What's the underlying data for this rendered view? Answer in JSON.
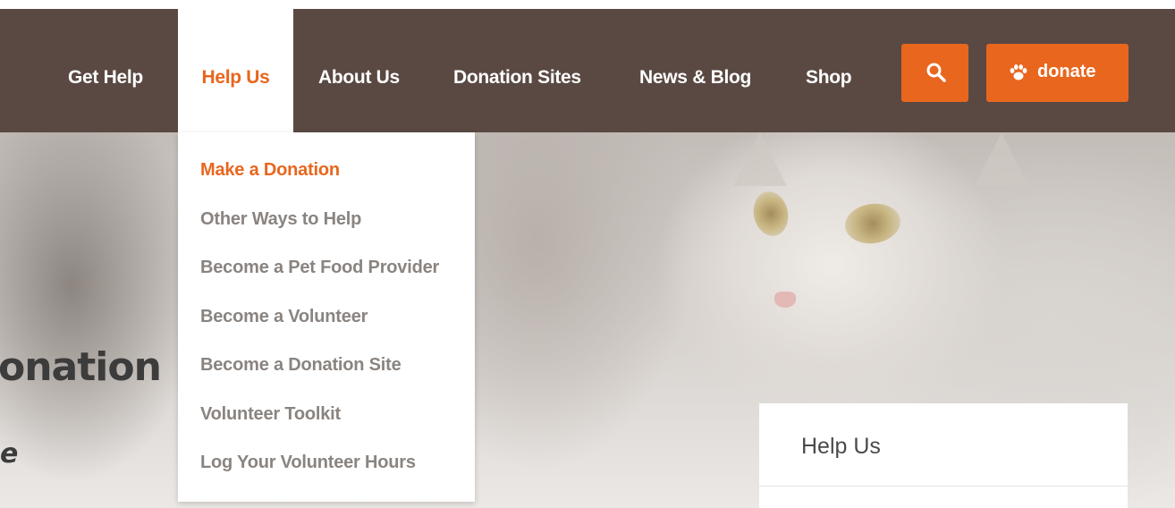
{
  "nav": {
    "items": [
      {
        "label": "Get Help",
        "active": false
      },
      {
        "label": "Help Us",
        "active": true
      },
      {
        "label": "About Us",
        "active": false
      },
      {
        "label": "Donation Sites",
        "active": false
      },
      {
        "label": "News & Blog",
        "active": false
      },
      {
        "label": "Shop",
        "active": false
      }
    ],
    "search_icon": "search-icon",
    "donate_label": "donate",
    "donate_icon": "paw-icon"
  },
  "dropdown": {
    "items": [
      {
        "label": "Make a Donation",
        "active": true
      },
      {
        "label": "Other Ways to Help",
        "active": false
      },
      {
        "label": "Become a Pet Food Provider",
        "active": false
      },
      {
        "label": "Become a Volunteer",
        "active": false
      },
      {
        "label": "Become a Donation Site",
        "active": false
      },
      {
        "label": "Volunteer Toolkit",
        "active": false
      },
      {
        "label": "Log Your Volunteer Hours",
        "active": false
      }
    ]
  },
  "hero": {
    "title_fragment": "onation",
    "subtitle_fragment": "e"
  },
  "side_card": {
    "title": "Help Us"
  },
  "colors": {
    "header_bg": "#5a4942",
    "accent": "#e8661e",
    "dropdown_text": "#8a8480"
  }
}
